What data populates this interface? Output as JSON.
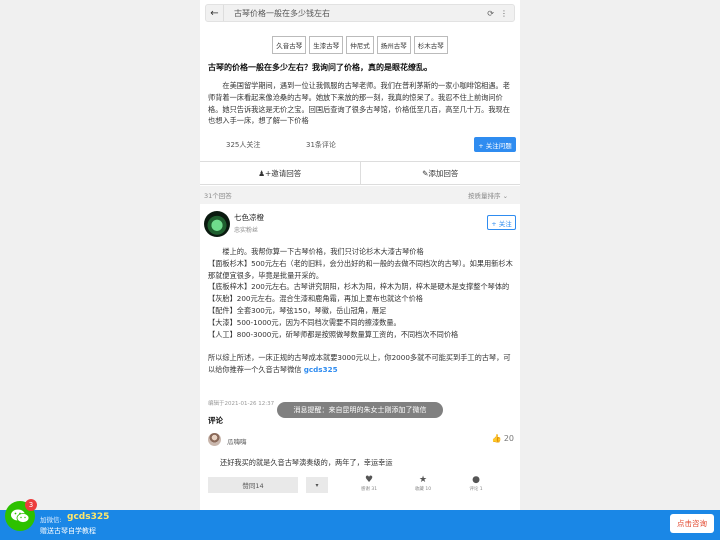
{
  "search": {
    "query": "古琴价格一般在多少钱左右"
  },
  "tags": [
    "久音古琴",
    "生漆古琴",
    "仲尼式",
    "扬州古琴",
    "杉木古琴"
  ],
  "question": {
    "title": "古琴的价格一般在多少左右？我询问了价格，真的是眼花缭乱。",
    "body": "在美国留学期间，遇到一位让我佩服的古琴老师。我们在普利茅斯的一家小咖啡馆相遇。老师背着一床看起来像沧桑的古琴。她放下来放的那一刻，我真的惊呆了。我忍不住上前询问价格。她只告诉我这是无价之宝。回国后查询了很多古琴馆，价格低至几百，高至几十万。我现在也想入手一床，想了解一下价格",
    "followers": "325人关注",
    "comments": "31条评论",
    "follow_label": "+ 关注问题"
  },
  "actions": {
    "invite": "邀请回答",
    "add_answer": "添加回答"
  },
  "answers_bar": {
    "count": "31个回答",
    "sort": "按质量排序"
  },
  "answer": {
    "author": "七色凉橙",
    "author_sub": "忠实粉丝",
    "follow_label": "+ 关注",
    "lines": [
      "楼上的。我帮你算一下古琴价格，我们只讨论杉木大漆古琴价格",
      "【面板杉木】500元左右（老的旧料，会分出好的和一般的去做不同档次的古琴）。如果用新杉木那就便宜很多，毕竟是批量开采的。",
      "【底板梓木】200元左右。古琴讲究阴阳，杉木为阳，梓木为阴，梓木是硬木是支撑整个琴体的",
      "【灰胎】200元左右。混合生漆和鹿角霜，再加上夏布也就这个价格",
      "【配件】全套300元，琴弦150，琴徽，岳山冠角，雁足",
      "【大漆】500-1000元，因为不同档次需要不同的擦漆数量。",
      "【人工】800-3000元，斫琴师都是按照做琴数量算工资的，不同档次不同价格"
    ],
    "summary": "所以综上所述，一床正规的古琴成本就要3000元以上，你2000多就不可能买到手工的古琴，可以给你推荐一个久音古琴微信",
    "wechat": "gcds325",
    "edited": "编辑于2021-01-26 12:37"
  },
  "toast": "消息提醒：来自昆明的朱女士刚添加了微信",
  "comments": {
    "heading": "评论",
    "name": "瓜嗨嗨",
    "likes": "20",
    "text": "还好我买的就是久音古琴演奏级的，两年了，幸运幸运"
  },
  "bottom": {
    "upvote": "赞同14",
    "thanks": "感谢 31",
    "collect": "收藏 10",
    "comment": "评论 1"
  },
  "footer": {
    "badge": "3",
    "label": "加微信:",
    "wechat": "gcds325",
    "desc": "赠送古琴自学教程",
    "consult": "点击咨询"
  },
  "colors": {
    "accent": "#2f8cf0",
    "footer": "#1a87e6",
    "wechat_green": "#2dc100",
    "highlight": "#ffe86b"
  },
  "icons": [
    "back-arrow-icon",
    "share-icon",
    "more-icon",
    "invite-icon",
    "edit-icon",
    "chevron-down-icon",
    "thumb-up-icon",
    "heart-icon",
    "star-icon",
    "comment-icon",
    "wechat-icon"
  ]
}
